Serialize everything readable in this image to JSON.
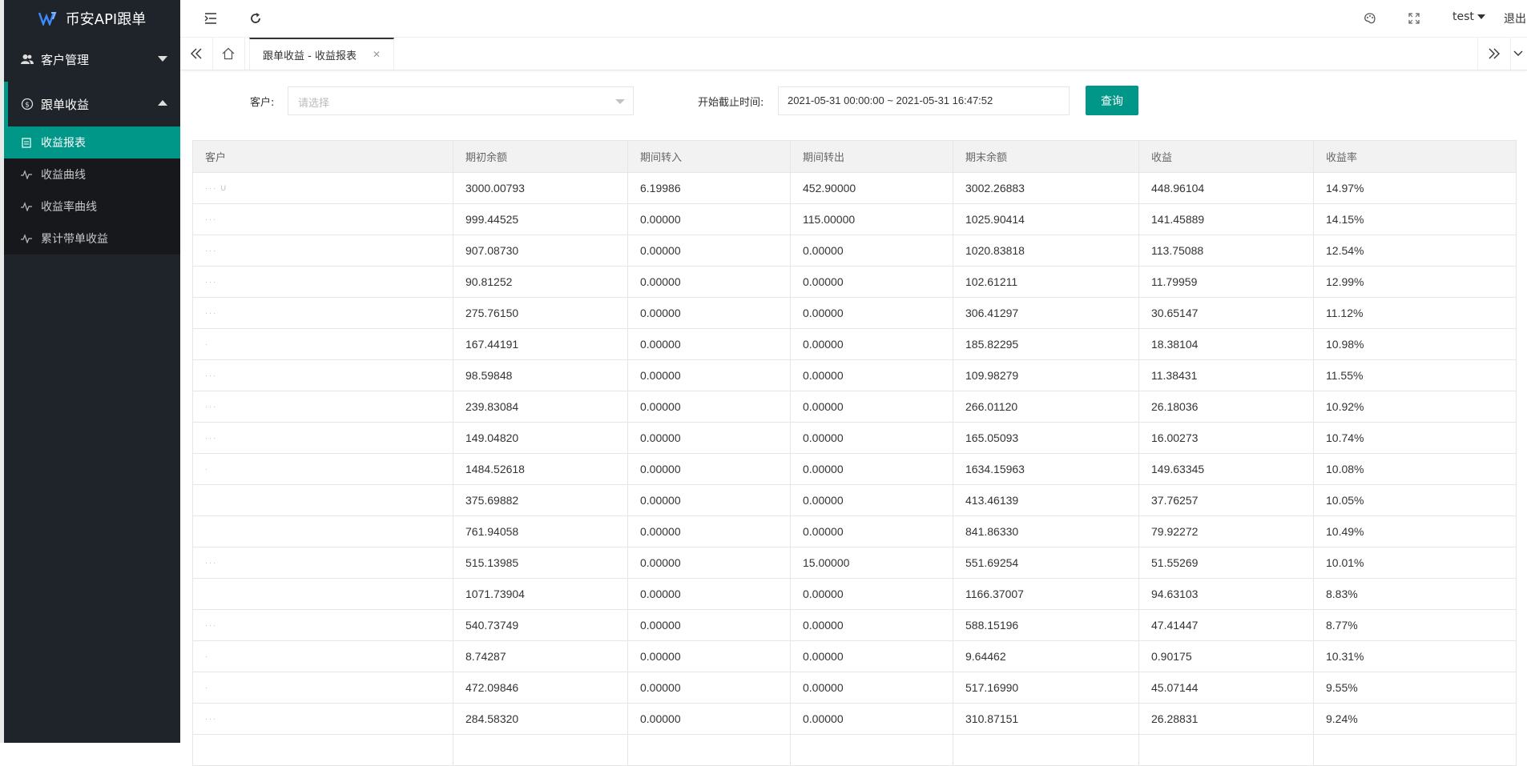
{
  "app": {
    "title": "币安API跟单"
  },
  "header": {
    "user": "test",
    "logout": "退出"
  },
  "sidebar": {
    "groups": [
      {
        "label": "客户管理"
      },
      {
        "label": "跟单收益",
        "items": [
          "收益报表",
          "收益曲线",
          "收益率曲线",
          "累计带单收益"
        ]
      }
    ]
  },
  "tabs": {
    "current": "跟单收益 - 收益报表"
  },
  "filter": {
    "customer_label": "客户:",
    "customer_placeholder": "请选择",
    "time_label": "开始截止时间:",
    "time_value": "2021-05-31 00:00:00 ~ 2021-05-31 16:47:52",
    "query": "查询"
  },
  "table": {
    "headers": [
      "客户",
      "期初余额",
      "期间转入",
      "期间转出",
      "期末余额",
      "收益",
      "收益率"
    ],
    "rows": [
      [
        "··· U",
        "3000.00793",
        "6.19986",
        "452.90000",
        "3002.26883",
        "448.96104",
        "14.97%"
      ],
      [
        "···",
        "999.44525",
        "0.00000",
        "115.00000",
        "1025.90414",
        "141.45889",
        "14.15%"
      ],
      [
        "···",
        "907.08730",
        "0.00000",
        "0.00000",
        "1020.83818",
        "113.75088",
        "12.54%"
      ],
      [
        "···",
        "90.81252",
        "0.00000",
        "0.00000",
        "102.61211",
        "11.79959",
        "12.99%"
      ],
      [
        "···",
        "275.76150",
        "0.00000",
        "0.00000",
        "306.41297",
        "30.65147",
        "11.12%"
      ],
      [
        "·",
        "167.44191",
        "0.00000",
        "0.00000",
        "185.82295",
        "18.38104",
        "10.98%"
      ],
      [
        "···",
        "98.59848",
        "0.00000",
        "0.00000",
        "109.98279",
        "11.38431",
        "11.55%"
      ],
      [
        "···",
        "239.83084",
        "0.00000",
        "0.00000",
        "266.01120",
        "26.18036",
        "10.92%"
      ],
      [
        "···",
        "149.04820",
        "0.00000",
        "0.00000",
        "165.05093",
        "16.00273",
        "10.74%"
      ],
      [
        "·",
        "1484.52618",
        "0.00000",
        "0.00000",
        "1634.15963",
        "149.63345",
        "10.08%"
      ],
      [
        "",
        "375.69882",
        "0.00000",
        "0.00000",
        "413.46139",
        "37.76257",
        "10.05%"
      ],
      [
        "",
        "761.94058",
        "0.00000",
        "0.00000",
        "841.86330",
        "79.92272",
        "10.49%"
      ],
      [
        "···",
        "515.13985",
        "0.00000",
        "15.00000",
        "551.69254",
        "51.55269",
        "10.01%"
      ],
      [
        "",
        "1071.73904",
        "0.00000",
        "0.00000",
        "1166.37007",
        "94.63103",
        "8.83%"
      ],
      [
        "···",
        "540.73749",
        "0.00000",
        "0.00000",
        "588.15196",
        "47.41447",
        "8.77%"
      ],
      [
        "·",
        "8.74287",
        "0.00000",
        "0.00000",
        "9.64462",
        "0.90175",
        "10.31%"
      ],
      [
        "·",
        "472.09846",
        "0.00000",
        "0.00000",
        "517.16990",
        "45.07144",
        "9.55%"
      ],
      [
        "···",
        "284.58320",
        "0.00000",
        "0.00000",
        "310.87151",
        "26.28831",
        "9.24%"
      ],
      [
        "",
        "",
        "",
        "",
        "",
        "",
        ""
      ]
    ]
  }
}
